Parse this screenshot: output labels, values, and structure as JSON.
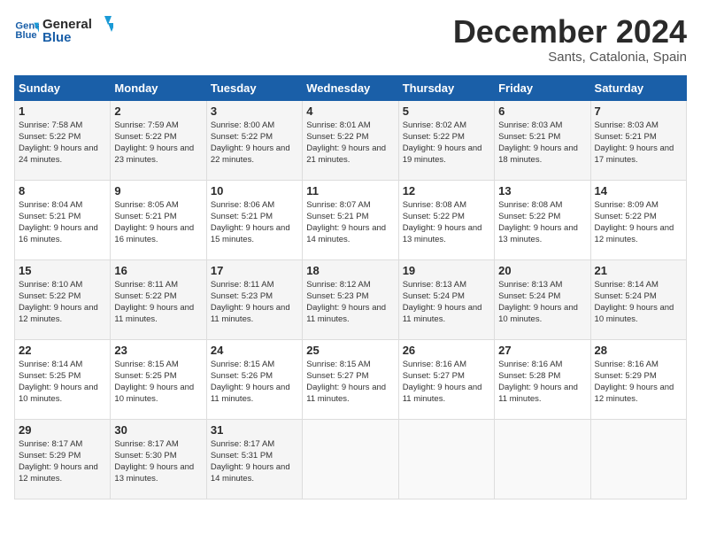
{
  "logo": {
    "line1": "General",
    "line2": "Blue"
  },
  "title": "December 2024",
  "location": "Sants, Catalonia, Spain",
  "days_header": [
    "Sunday",
    "Monday",
    "Tuesday",
    "Wednesday",
    "Thursday",
    "Friday",
    "Saturday"
  ],
  "weeks": [
    [
      {
        "num": "1",
        "rise": "7:58 AM",
        "set": "5:22 PM",
        "daylight": "9 hours and 24 minutes."
      },
      {
        "num": "2",
        "rise": "7:59 AM",
        "set": "5:22 PM",
        "daylight": "9 hours and 23 minutes."
      },
      {
        "num": "3",
        "rise": "8:00 AM",
        "set": "5:22 PM",
        "daylight": "9 hours and 22 minutes."
      },
      {
        "num": "4",
        "rise": "8:01 AM",
        "set": "5:22 PM",
        "daylight": "9 hours and 21 minutes."
      },
      {
        "num": "5",
        "rise": "8:02 AM",
        "set": "5:22 PM",
        "daylight": "9 hours and 19 minutes."
      },
      {
        "num": "6",
        "rise": "8:03 AM",
        "set": "5:21 PM",
        "daylight": "9 hours and 18 minutes."
      },
      {
        "num": "7",
        "rise": "8:03 AM",
        "set": "5:21 PM",
        "daylight": "9 hours and 17 minutes."
      }
    ],
    [
      {
        "num": "8",
        "rise": "8:04 AM",
        "set": "5:21 PM",
        "daylight": "9 hours and 16 minutes."
      },
      {
        "num": "9",
        "rise": "8:05 AM",
        "set": "5:21 PM",
        "daylight": "9 hours and 16 minutes."
      },
      {
        "num": "10",
        "rise": "8:06 AM",
        "set": "5:21 PM",
        "daylight": "9 hours and 15 minutes."
      },
      {
        "num": "11",
        "rise": "8:07 AM",
        "set": "5:21 PM",
        "daylight": "9 hours and 14 minutes."
      },
      {
        "num": "12",
        "rise": "8:08 AM",
        "set": "5:22 PM",
        "daylight": "9 hours and 13 minutes."
      },
      {
        "num": "13",
        "rise": "8:08 AM",
        "set": "5:22 PM",
        "daylight": "9 hours and 13 minutes."
      },
      {
        "num": "14",
        "rise": "8:09 AM",
        "set": "5:22 PM",
        "daylight": "9 hours and 12 minutes."
      }
    ],
    [
      {
        "num": "15",
        "rise": "8:10 AM",
        "set": "5:22 PM",
        "daylight": "9 hours and 12 minutes."
      },
      {
        "num": "16",
        "rise": "8:11 AM",
        "set": "5:22 PM",
        "daylight": "9 hours and 11 minutes."
      },
      {
        "num": "17",
        "rise": "8:11 AM",
        "set": "5:23 PM",
        "daylight": "9 hours and 11 minutes."
      },
      {
        "num": "18",
        "rise": "8:12 AM",
        "set": "5:23 PM",
        "daylight": "9 hours and 11 minutes."
      },
      {
        "num": "19",
        "rise": "8:13 AM",
        "set": "5:24 PM",
        "daylight": "9 hours and 11 minutes."
      },
      {
        "num": "20",
        "rise": "8:13 AM",
        "set": "5:24 PM",
        "daylight": "9 hours and 10 minutes."
      },
      {
        "num": "21",
        "rise": "8:14 AM",
        "set": "5:24 PM",
        "daylight": "9 hours and 10 minutes."
      }
    ],
    [
      {
        "num": "22",
        "rise": "8:14 AM",
        "set": "5:25 PM",
        "daylight": "9 hours and 10 minutes."
      },
      {
        "num": "23",
        "rise": "8:15 AM",
        "set": "5:25 PM",
        "daylight": "9 hours and 10 minutes."
      },
      {
        "num": "24",
        "rise": "8:15 AM",
        "set": "5:26 PM",
        "daylight": "9 hours and 11 minutes."
      },
      {
        "num": "25",
        "rise": "8:15 AM",
        "set": "5:27 PM",
        "daylight": "9 hours and 11 minutes."
      },
      {
        "num": "26",
        "rise": "8:16 AM",
        "set": "5:27 PM",
        "daylight": "9 hours and 11 minutes."
      },
      {
        "num": "27",
        "rise": "8:16 AM",
        "set": "5:28 PM",
        "daylight": "9 hours and 11 minutes."
      },
      {
        "num": "28",
        "rise": "8:16 AM",
        "set": "5:29 PM",
        "daylight": "9 hours and 12 minutes."
      }
    ],
    [
      {
        "num": "29",
        "rise": "8:17 AM",
        "set": "5:29 PM",
        "daylight": "9 hours and 12 minutes."
      },
      {
        "num": "30",
        "rise": "8:17 AM",
        "set": "5:30 PM",
        "daylight": "9 hours and 13 minutes."
      },
      {
        "num": "31",
        "rise": "8:17 AM",
        "set": "5:31 PM",
        "daylight": "9 hours and 14 minutes."
      },
      null,
      null,
      null,
      null
    ]
  ],
  "labels": {
    "sunrise": "Sunrise:",
    "sunset": "Sunset:",
    "daylight": "Daylight:"
  }
}
